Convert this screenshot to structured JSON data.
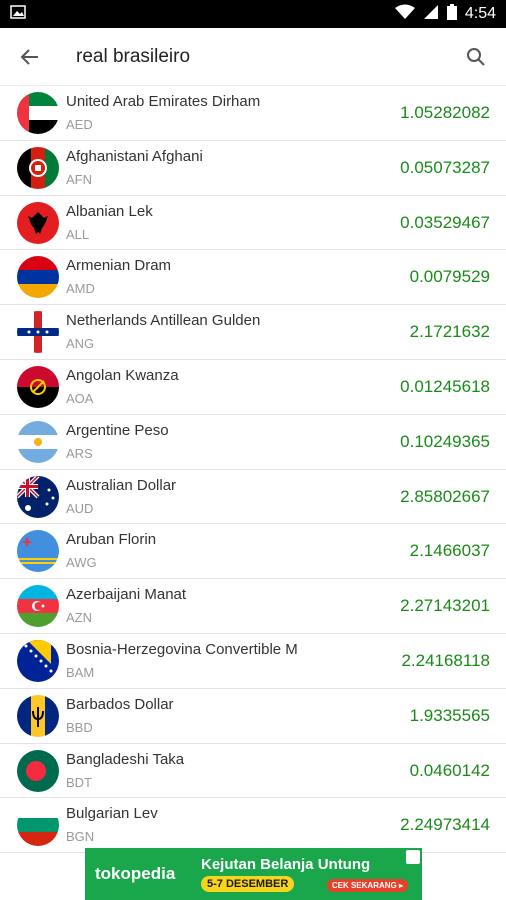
{
  "status_bar": {
    "time": "4:54"
  },
  "search": {
    "query": "real brasileiro"
  },
  "currencies": [
    {
      "name": "United Arab Emirates Dirham",
      "code": "AED",
      "value": "1.05282082"
    },
    {
      "name": "Afghanistani Afghani",
      "code": "AFN",
      "value": "0.05073287"
    },
    {
      "name": "Albanian Lek",
      "code": "ALL",
      "value": "0.03529467"
    },
    {
      "name": "Armenian Dram",
      "code": "AMD",
      "value": "0.0079529"
    },
    {
      "name": "Netherlands Antillean Gulden",
      "code": "ANG",
      "value": "2.1721632"
    },
    {
      "name": "Angolan Kwanza",
      "code": "AOA",
      "value": "0.01245618"
    },
    {
      "name": "Argentine Peso",
      "code": "ARS",
      "value": "0.10249365"
    },
    {
      "name": "Australian Dollar",
      "code": "AUD",
      "value": "2.85802667"
    },
    {
      "name": "Aruban Florin",
      "code": "AWG",
      "value": "2.1466037"
    },
    {
      "name": "Azerbaijani Manat",
      "code": "AZN",
      "value": "2.27143201"
    },
    {
      "name": "Bosnia-Herzegovina Convertible M",
      "code": "BAM",
      "value": "2.24168118"
    },
    {
      "name": "Barbados Dollar",
      "code": "BBD",
      "value": "1.9335565"
    },
    {
      "name": "Bangladeshi Taka",
      "code": "BDT",
      "value": "0.0460142"
    },
    {
      "name": "Bulgarian Lev",
      "code": "BGN",
      "value": "2.24973414"
    }
  ],
  "ad": {
    "brand": "tokopedia",
    "title": "Kejutan Belanja Untung",
    "date": "5-7 DESEMBER",
    "cta": "CEK SEKARANG ▸"
  },
  "colors": {
    "value_green": "#1a8a1a",
    "ad_green": "#1aa64b"
  }
}
